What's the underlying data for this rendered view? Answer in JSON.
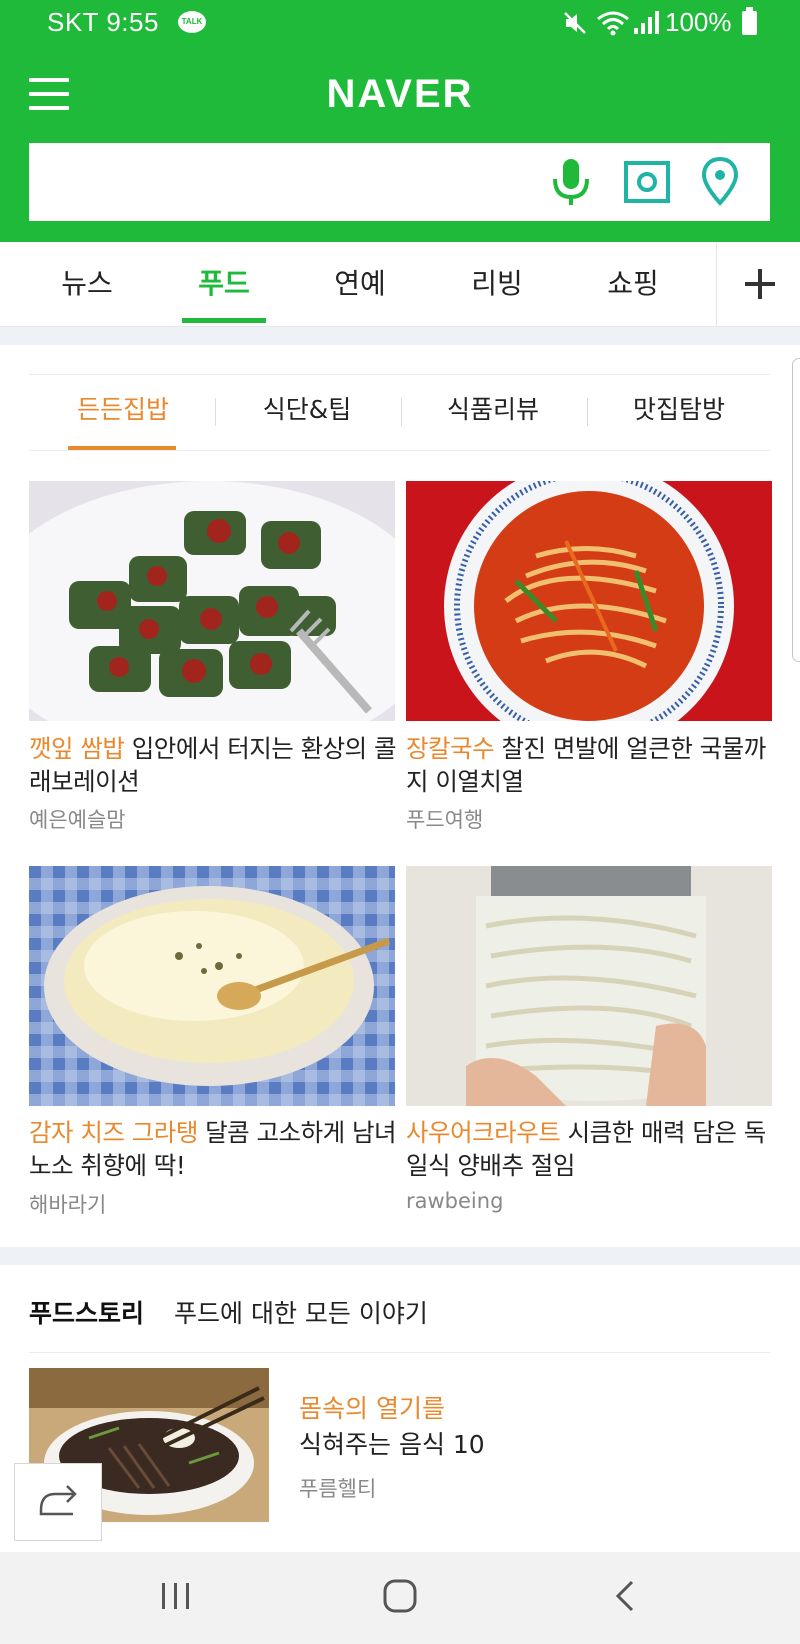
{
  "status_bar": {
    "carrier_time": "SKT 9:55",
    "talk_badge": "TALK",
    "battery_text": "100%",
    "icons": [
      "kakaotalk-icon",
      "mute-icon",
      "wifi-icon",
      "signal-icon",
      "battery-icon"
    ]
  },
  "header": {
    "logo": "NAVER",
    "search_placeholder": "",
    "icons": [
      "voice-search-icon",
      "image-search-icon",
      "location-search-icon"
    ],
    "brand_color": "#1fba3a"
  },
  "tabs": [
    {
      "label": "뉴스",
      "active": false
    },
    {
      "label": "푸드",
      "active": true
    },
    {
      "label": "연예",
      "active": false
    },
    {
      "label": "리빙",
      "active": false
    },
    {
      "label": "쇼핑",
      "active": false
    }
  ],
  "subtabs": [
    {
      "label": "든든집밥",
      "active": true
    },
    {
      "label": "식단&팁",
      "active": false
    },
    {
      "label": "식품리뷰",
      "active": false
    },
    {
      "label": "맛집탐방",
      "active": false
    }
  ],
  "accent_color": "#e8892e",
  "cards": [
    {
      "highlight": "깻잎 쌈밥",
      "title": " 입안에서 터지는 환상의 콜래보레이션",
      "author": "예은예슬맘"
    },
    {
      "highlight": "장칼국수",
      "title": " 찰진 면발에 얼큰한 국물까지 이열치열",
      "author": "푸드여행"
    },
    {
      "highlight": "감자 치즈 그라탱",
      "title": " 달콤 고소하게 남녀노소 취향에 딱!",
      "author": "해바라기"
    },
    {
      "highlight": "사우어크라우트",
      "title": " 시큼한 매력 담은 독일식 양배추 절임",
      "author": "rawbeing"
    }
  ],
  "food_story": {
    "title": "푸드스토리",
    "subtitle": "푸드에 대한 모든 이야기",
    "item": {
      "highlight": "몸속의 열기를",
      "title": "식혀주는 음식 10",
      "author": "푸름헬티"
    }
  }
}
